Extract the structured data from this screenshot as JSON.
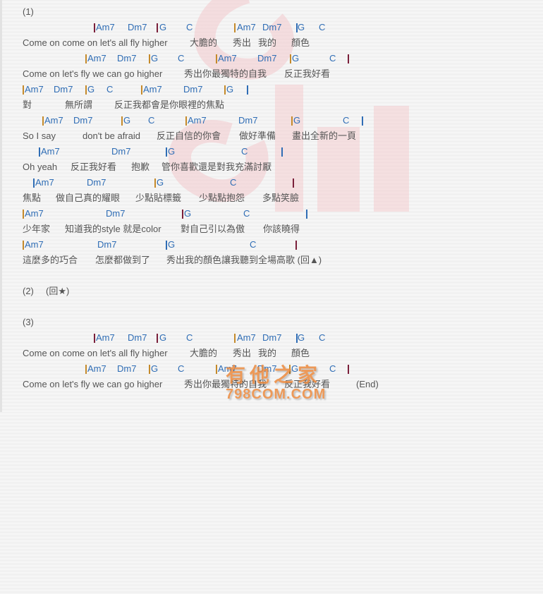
{
  "sections": {
    "s1": "(1)",
    "s2": "(2)",
    "s2_repeat": "(回★)",
    "s3": "(3)"
  },
  "lines": [
    {
      "type": "chord",
      "tokens": [
        "|Am7",
        "Dm7",
        "|G",
        "C",
        "|Am7",
        "Dm7",
        "|G",
        "C",
        "|"
      ]
    },
    {
      "type": "lyric",
      "tokens": [
        "Come on come on let's all fly higher",
        "大膽的",
        "秀出",
        "我的",
        "顏色"
      ]
    },
    {
      "type": "chord",
      "tokens": [
        "|Am7",
        "Dm7",
        "|G",
        "C",
        "|Am7",
        "Dm7",
        "|G",
        "C",
        "|"
      ]
    },
    {
      "type": "lyric",
      "tokens": [
        "Come on let's fly we can go higher",
        "秀出你最獨特的自我",
        "反正我好看"
      ]
    },
    {
      "type": "chord",
      "tokens": [
        "|Am7",
        "Dm7",
        "|G",
        "C",
        "|Am7",
        "Dm7",
        "|G",
        "|"
      ]
    },
    {
      "type": "lyric",
      "tokens": [
        "對",
        "無所謂",
        "反正我都會是你眼裡的焦點"
      ]
    },
    {
      "type": "chord",
      "tokens": [
        "|Am7",
        "Dm7",
        "|G",
        "C",
        "|Am7",
        "Dm7",
        "|G",
        "C",
        "|"
      ]
    },
    {
      "type": "lyric",
      "tokens": [
        "So I say",
        "don't be afraid",
        "反正自信的你會",
        "做好準備",
        "畫出全新的一頁"
      ]
    },
    {
      "type": "chord",
      "tokens": [
        "|Am7",
        "Dm7",
        "|G",
        "C",
        "|"
      ]
    },
    {
      "type": "lyric",
      "tokens": [
        "Oh yeah",
        "反正我好看",
        "抱歉",
        "管你喜歡還是對我充滿討厭"
      ]
    },
    {
      "type": "chord",
      "tokens": [
        "|Am7",
        "Dm7",
        "|G",
        "C",
        "|"
      ]
    },
    {
      "type": "lyric",
      "tokens": [
        "焦點",
        "做自己真的耀眼",
        "少點貼標籤",
        "少點點抱怨",
        "多點笑臉"
      ]
    },
    {
      "type": "chord",
      "tokens": [
        "|Am7",
        "Dm7",
        "|G",
        "C",
        "|"
      ]
    },
    {
      "type": "lyric",
      "tokens": [
        "少年家",
        "知道我的style 就是color",
        "對自己引以為傲",
        "你該曉得"
      ]
    },
    {
      "type": "chord",
      "tokens": [
        "|Am7",
        "Dm7",
        "|G",
        "C",
        "|"
      ]
    },
    {
      "type": "lyric",
      "tokens": [
        "這麼多的巧合",
        "怎麼都做到了",
        "秀出我的顏色讓我聽到全場高歌 (回▲)"
      ]
    },
    {
      "type": "chord",
      "tokens": [
        "|Am7",
        "Dm7",
        "|G",
        "C",
        "|Am7",
        "Dm7",
        "|G",
        "C",
        "|"
      ]
    },
    {
      "type": "lyric",
      "tokens": [
        "Come on come on let's all fly higher",
        "大膽的",
        "秀出",
        "我的",
        "顏色"
      ]
    },
    {
      "type": "chord",
      "tokens": [
        "|Am7",
        "Dm7",
        "|G",
        "C",
        "|Am7",
        "Dm7",
        "|G",
        "C",
        "|"
      ]
    },
    {
      "type": "lyric",
      "tokens": [
        "Come on let's fly we can go higher",
        "秀出你最獨特的自我",
        "反正我好看",
        "(End)"
      ]
    }
  ],
  "watermark": {
    "cn": "有他之家",
    "en": "798COM.COM"
  },
  "colors": {
    "chord": "#2f6db5",
    "lyric": "#555555",
    "background": "#f1f1f1",
    "watermark_orange": "#ec8a3e",
    "watermark_logo": "#f3c9cc"
  }
}
